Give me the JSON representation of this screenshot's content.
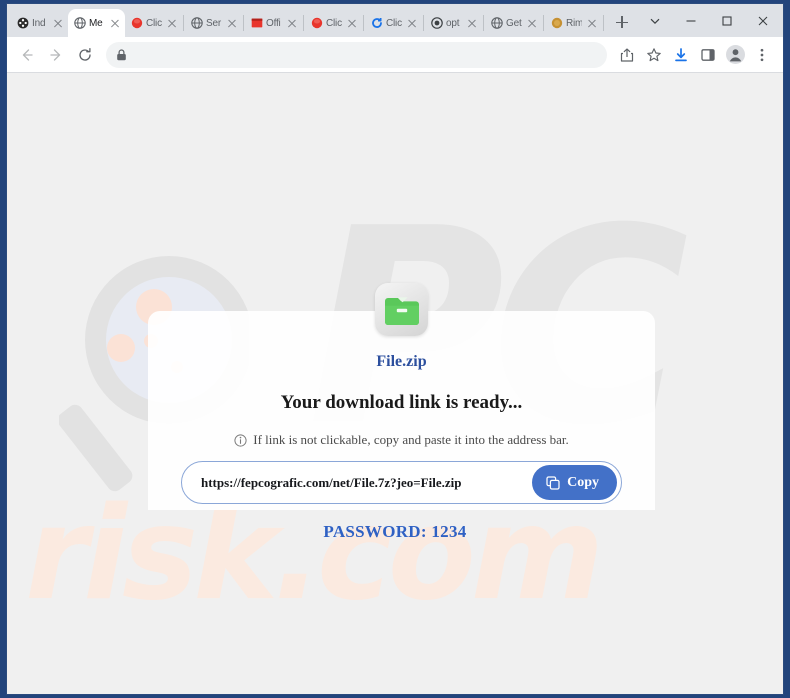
{
  "window": {
    "controls": [
      {
        "name": "tab-search",
        "icon": "chevron-down-icon",
        "label": "∨"
      },
      {
        "name": "minimize",
        "icon": "minimize-icon",
        "label": "–"
      },
      {
        "name": "maximize",
        "icon": "maximize-icon",
        "label": "□"
      },
      {
        "name": "close",
        "icon": "close-icon",
        "label": "✕"
      }
    ]
  },
  "tabs": [
    {
      "title": "Ind",
      "favicon": "film-reel-icon",
      "favicon_color": "#2b2b2b",
      "active": false,
      "separator_after": false
    },
    {
      "title": "Me",
      "favicon": "globe-icon",
      "favicon_color": "#5f6368",
      "active": true,
      "separator_after": false
    },
    {
      "title": "Clic",
      "favicon": "red-circle-icon",
      "favicon_color": "#e8352c",
      "active": false,
      "separator_after": true
    },
    {
      "title": "Ser",
      "favicon": "globe-icon",
      "favicon_color": "#5f6368",
      "active": false,
      "separator_after": true
    },
    {
      "title": "Offi",
      "favicon": "red-window-icon",
      "favicon_color": "#e8352c",
      "active": false,
      "separator_after": true
    },
    {
      "title": "Clic",
      "favicon": "red-circle-icon",
      "favicon_color": "#e8352c",
      "active": false,
      "separator_after": true
    },
    {
      "title": "Clic",
      "favicon": "blue-refresh-icon",
      "favicon_color": "#1a73e8",
      "active": false,
      "separator_after": true
    },
    {
      "title": "opt",
      "favicon": "target-icon",
      "favicon_color": "#3c4043",
      "active": false,
      "separator_after": true
    },
    {
      "title": "Get",
      "favicon": "globe-icon",
      "favicon_color": "#5f6368",
      "active": false,
      "separator_after": true
    },
    {
      "title": "Rim",
      "favicon": "amber-circle-icon",
      "favicon_color": "#c69133",
      "active": false,
      "separator_after": true
    }
  ],
  "new_tab": {
    "label": "New tab"
  },
  "toolbar": {
    "back_label": "Back",
    "forward_label": "Forward",
    "reload_label": "Reload",
    "omnibox": {
      "value": "",
      "placeholder": "",
      "lock_icon": "lock-icon"
    },
    "share_label": "Share",
    "bookmark_label": "Bookmark this tab",
    "download_label": "Downloads",
    "sidepanel_label": "Side panel",
    "profile_label": "Profile",
    "menu_label": "Customize and control Google Chrome"
  },
  "page": {
    "watermark_top": "PC",
    "watermark_bottom": "risk.com",
    "file_name": "File.zip",
    "file_icon": "zip-folder-icon",
    "headline": "Your download link is ready...",
    "hint_icon": "info-circle-icon",
    "hint_text": "If link is not clickable, copy and paste it into the address bar.",
    "link_url": "https://fepcografic.com/net/File.7z?jeo=File.zip",
    "copy_button": {
      "label": "Copy",
      "icon": "copy-icon"
    },
    "password_text": "PASSWORD: 1234"
  },
  "colors": {
    "accent_blue": "#4371c8",
    "link_blue": "#2c4f9e",
    "password_blue": "#2f61c4",
    "zip_green": "#5ac85a",
    "window_border": "#2b4b7e",
    "page_bg": "#f0f0f0"
  }
}
